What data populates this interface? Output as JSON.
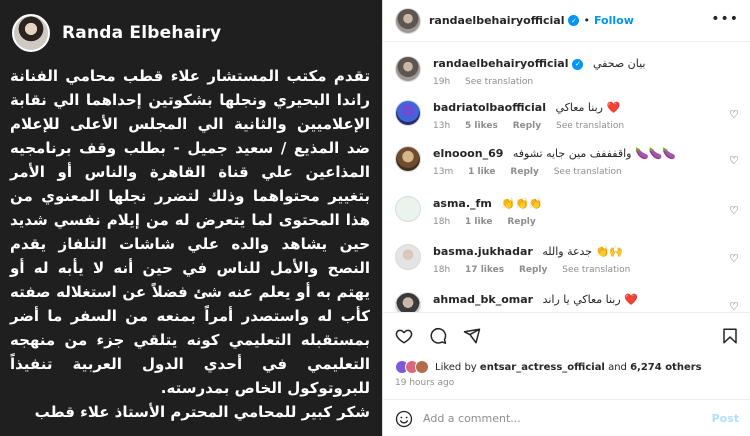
{
  "image_post": {
    "name": "Randa Elbehairy",
    "paragraph": "تقدم مكتب المستشار علاء قطب محامي الفنانة راندا البحيري ونجلها بشكوتين إحداهما الي نقابة الإعلاميين والثانية الي المجلس الأعلى للإعلام ضد المذيع / سعيد جميل - بطلب وقف برنامجيه المذاعين علي قناة القاهرة والناس أو الأمر بتغيير محتواهما وذلك لتضرر نجلها المعنوي من هذا المحتوى لما يتعرض له من إيلام نفسي شديد حين يشاهد والده علي شاشات التلفاز يقدم النصح والأمل للناس في حين أنه لا يأبه له أو يهتم به أو يعلم عنه شئ فضلاً عن استغلاله صفته كأب له واستصدر أمراً بمنعه من السفر ما أضر بمستقبله التعليمي كونه يتلقي جزء من منهجه التعليمي في أحدي الدول العربية تنفيذاً للبروتوكول الخاص بمدرسته.",
    "thanks": "شكر كبير للمحامي المحترم الأستاذ علاء قطب"
  },
  "header": {
    "username": "randaelbehairyofficial",
    "separator": "•",
    "follow_label": "Follow",
    "more_icon": "more-horizontal-icon"
  },
  "comments": [
    {
      "username": "randaelbehairyofficial",
      "verified": true,
      "text": "بيان صحفي",
      "time": "19h",
      "likes": "",
      "reply": "",
      "translate": "See translation",
      "like_icon": false
    },
    {
      "username": "badriatolbaofficial",
      "verified": false,
      "text": "ربنا معاكي ❤️",
      "time": "13h",
      "likes": "5 likes",
      "reply": "Reply",
      "translate": "See translation",
      "like_icon": true
    },
    {
      "username": "elnooon_69",
      "verified": false,
      "text": "واقفففف مين جايه تشوفه 🍆🍆🍆",
      "time": "13m",
      "likes": "1 like",
      "reply": "Reply",
      "translate": "See translation",
      "like_icon": true
    },
    {
      "username": "asma._fm",
      "verified": false,
      "text": "👏👏👏",
      "time": "18h",
      "likes": "1 like",
      "reply": "Reply",
      "translate": "",
      "like_icon": true
    },
    {
      "username": "basma.jukhadar",
      "verified": false,
      "text": "جدعة والله 👏🙌",
      "time": "18h",
      "likes": "17 likes",
      "reply": "Reply",
      "translate": "See translation",
      "like_icon": true
    },
    {
      "username": "ahmad_bk_omar",
      "verified": false,
      "text": "ربنا معاكي يا راند ❤️",
      "time": "",
      "likes": "",
      "reply": "",
      "translate": "",
      "like_icon": true
    }
  ],
  "actions": {
    "liked_by_prefix": "Liked by",
    "liked_by_user": "entsar_actress_official",
    "and_label": "and",
    "others_count": "6,274 others",
    "posted": "19 hours ago"
  },
  "add_comment": {
    "placeholder": "Add a comment...",
    "post_label": "Post"
  },
  "colors": {
    "accent": "#0095f6",
    "image_bg": "#1f1f1f",
    "heart_red": "#ed4956"
  }
}
